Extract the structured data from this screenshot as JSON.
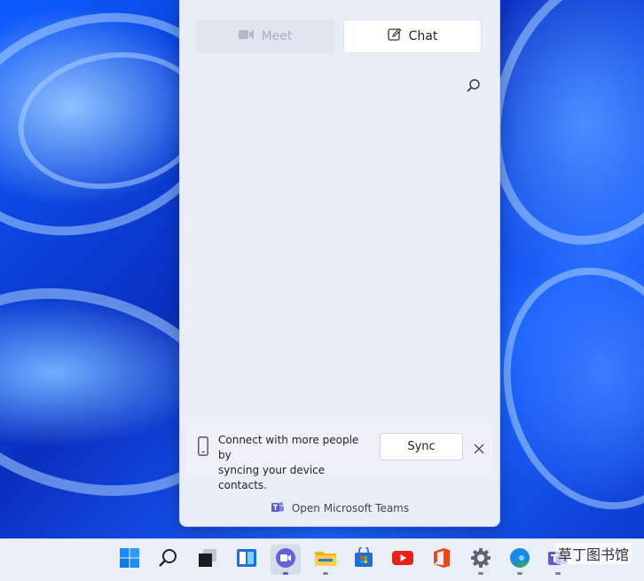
{
  "panel": {
    "meet_label": "Meet",
    "chat_label": "Chat",
    "search_icon": "search-icon",
    "sync_card": {
      "line1": "Connect with more people by",
      "line2": "syncing your device contacts.",
      "button_label": "Sync",
      "close_icon": "close-icon",
      "phone_icon": "phone-icon"
    },
    "open_teams_label": "Open Microsoft Teams"
  },
  "taskbar": {
    "items": [
      {
        "name": "start-icon"
      },
      {
        "name": "search-icon"
      },
      {
        "name": "task-view-icon"
      },
      {
        "name": "widgets-icon"
      },
      {
        "name": "teams-chat-icon",
        "active": true
      },
      {
        "name": "file-explorer-icon"
      },
      {
        "name": "microsoft-store-icon"
      },
      {
        "name": "youtube-icon"
      },
      {
        "name": "office-icon"
      },
      {
        "name": "settings-icon"
      },
      {
        "name": "edge-icon"
      },
      {
        "name": "teams-icon"
      }
    ]
  },
  "watermark": "草丁图书馆",
  "colors": {
    "accent": "#5b5fc7",
    "panel_bg": "#e9edf7",
    "taskbar_bg": "#e9eef7"
  }
}
